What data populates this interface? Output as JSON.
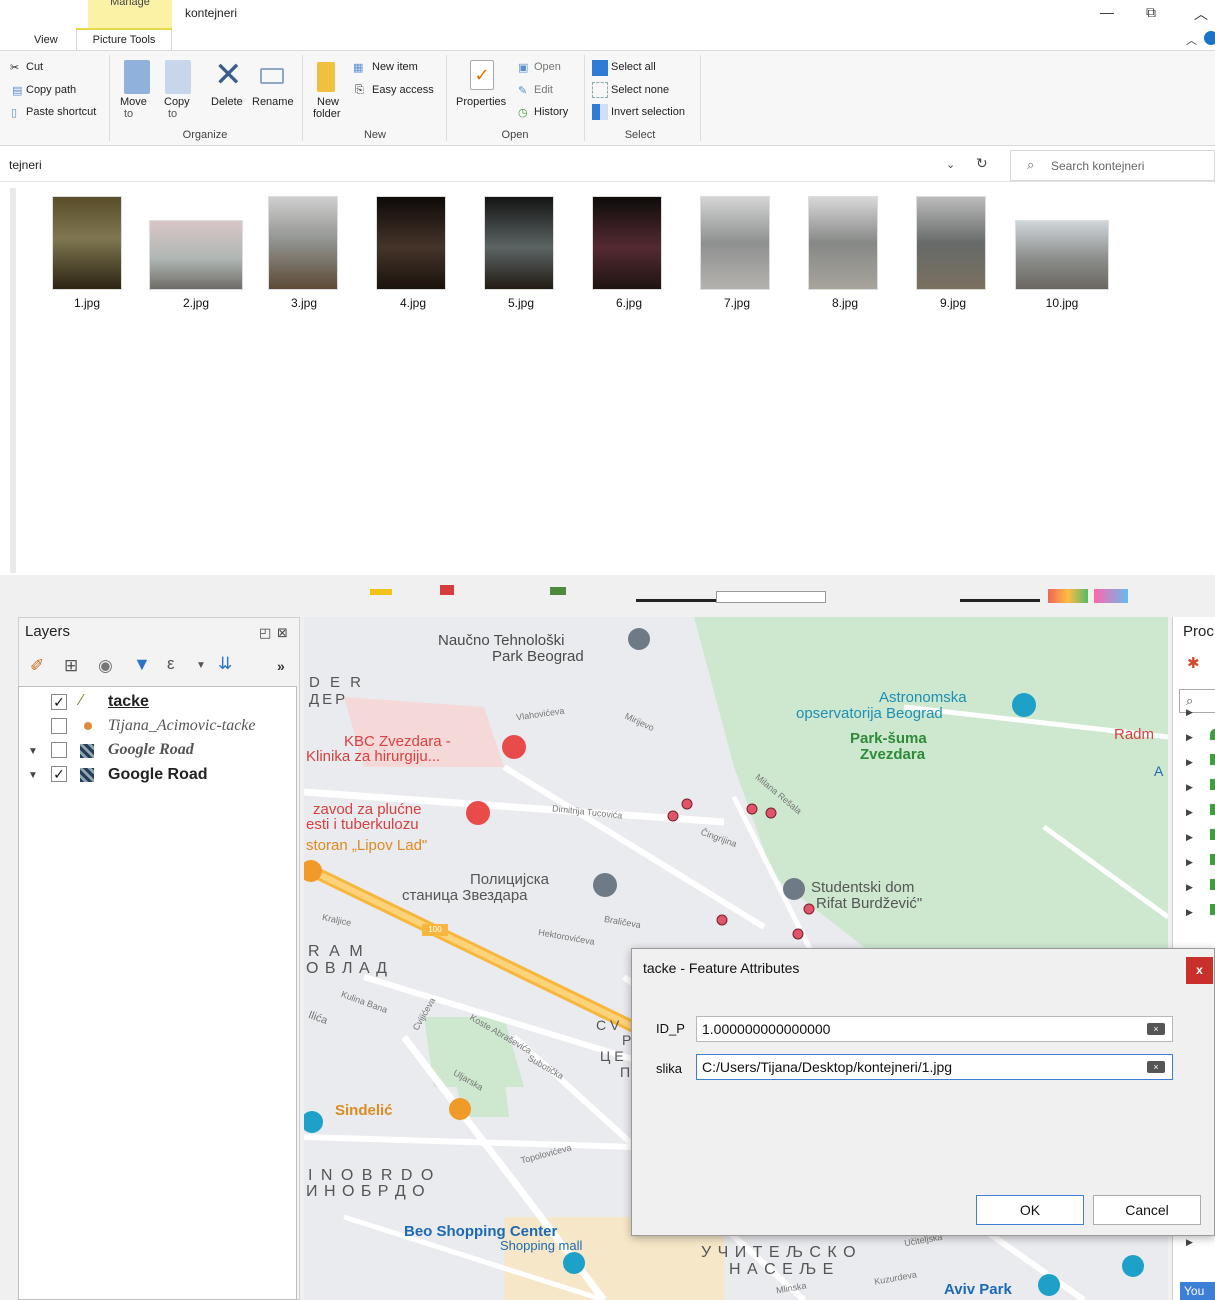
{
  "explorer": {
    "manage_tab": "Manage",
    "folder_title": "kontejneri",
    "tabs": [
      "View",
      "Picture Tools"
    ],
    "ribbon": {
      "clipboard": {
        "cut": "Cut",
        "copy_path": "Copy path",
        "paste_shortcut": "Paste shortcut"
      },
      "organize": {
        "move_to": "Move",
        "move_to2": "to",
        "copy_to": "Copy",
        "copy_to2": "to",
        "delete": "Delete",
        "rename": "Rename",
        "group": "Organize"
      },
      "new": {
        "new_folder": "New",
        "new_folder2": "folder",
        "new_item": "New item",
        "easy_access": "Easy access",
        "group": "New"
      },
      "open": {
        "properties": "Properties",
        "open": "Open",
        "edit": "Edit",
        "history": "History",
        "group": "Open"
      },
      "select": {
        "select_all": "Select all",
        "select_none": "Select none",
        "invert": "Invert selection",
        "group": "Select"
      }
    },
    "address": "tejneri",
    "search_placeholder": "Search kontejneri",
    "files": [
      "1.jpg",
      "2.jpg",
      "3.jpg",
      "4.jpg",
      "5.jpg",
      "6.jpg",
      "7.jpg",
      "8.jpg",
      "9.jpg",
      "10.jpg"
    ]
  },
  "qgis": {
    "layers_title": "Layers",
    "layers": [
      {
        "name": "tacke",
        "checked": true
      },
      {
        "name": "Tijana_Acimovic-tacke",
        "checked": false
      },
      {
        "name": "Google Road",
        "checked": false
      },
      {
        "name": "Google Road",
        "checked": true
      }
    ],
    "processing_title": "Proc",
    "map_labels": {
      "l1": "Naučno Tehnološki",
      "l2": "Park Beograd",
      "l3": "D E R",
      "l4": "ДЕР",
      "l5": "KBC Zvezdara -",
      "l6": "Klinika za hirurgiju...",
      "l7": "zavod za plućne",
      "l8": "esti i tuberkulozu",
      "l9": "storan „Lipov Lad\"",
      "l10": "Astronomska",
      "l11": "opservatorija Beograd",
      "l12": "Park-šuma",
      "l13": "Zvezdara",
      "l14": "Radm",
      "l15": "Полицијска",
      "l16": "станица Звездара",
      "l17": "Studentski dom",
      "l18": "Rifat Burdžević\"",
      "l19": "R A M",
      "l20": "О В  Л А Д",
      "l21": "Sindelić",
      "l22": "I N O  B R D O",
      "l23": "И Н О  Б Р Д О",
      "l24": "Beo Shopping Center",
      "l25": "Shopping mall",
      "l26": "У Ч И Т Е Љ С К О",
      "l27": "Н А С Е Љ Е",
      "l28": "Aviv Park",
      "l29": "Dimitrija Tucovića",
      "l30": "Hektorovićeva",
      "l31": "Braličeva",
      "l32": "Kraljice",
      "l33": "Koste Abraševića",
      "l34": "Subotička",
      "l35": "Uljarska",
      "l36": "Topolovićeva",
      "l37": "Ilića",
      "l38": "Kulina Bana",
      "l39": "Cvijićeva",
      "l40": "Milana Rešala",
      "l41": "Mirijevo",
      "l42": "Vlahovićeva",
      "l43": "Čingrijina",
      "l44": "C V",
      "l45": "P",
      "l46": "Ц Е",
      "l47": "П",
      "l48": "100",
      "l49": "A",
      "l50": "Kuzurdeva",
      "l51": "Učiteljska",
      "l52": "Mlinska"
    },
    "dialog": {
      "title": "tacke - Feature Attributes",
      "fields": [
        {
          "label": "ID_P",
          "value": "1.000000000000000"
        },
        {
          "label": "slika",
          "value": "C:/Users/Tijana/Desktop/kontejneri/1.jpg"
        }
      ],
      "ok": "OK",
      "cancel": "Cancel",
      "close": "x"
    },
    "status": "You"
  },
  "colors": {
    "accent": "#1a73c8",
    "dialog_close": "#c9302c",
    "point": "#e0556a"
  }
}
